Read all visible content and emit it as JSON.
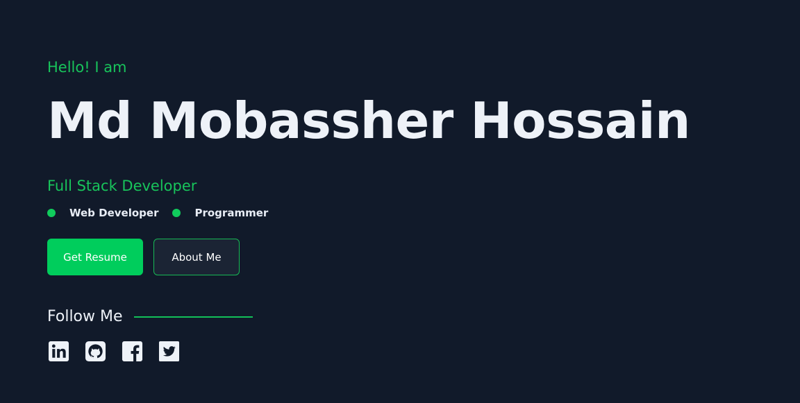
{
  "hero": {
    "greeting": "Hello! I am",
    "name": "Md Mobassher Hossain",
    "role": "Full Stack Developer",
    "skills": [
      {
        "label": "Web Developer"
      },
      {
        "label": "Programmer"
      }
    ],
    "buttons": {
      "resume_label": "Get Resume",
      "about_label": "About Me"
    },
    "follow": {
      "label": "Follow Me"
    },
    "socials": [
      {
        "icon": "linkedin-icon"
      },
      {
        "icon": "github-icon"
      },
      {
        "icon": "facebook-icon"
      },
      {
        "icon": "twitter-icon"
      }
    ]
  },
  "colors": {
    "background": "#111a2a",
    "accent": "#00cd5c",
    "text": "#eef2f8"
  }
}
